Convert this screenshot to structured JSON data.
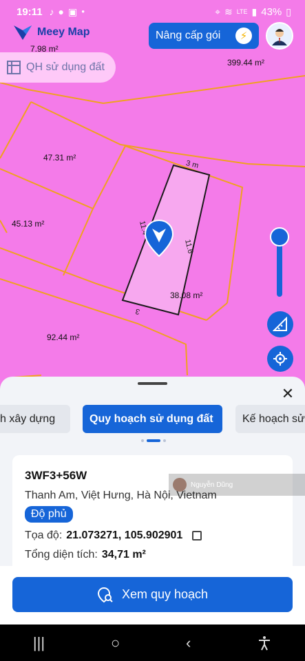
{
  "status_bar": {
    "time": "19:11",
    "battery": "43%",
    "left_icons": [
      "tiktok-icon",
      "mic-icon",
      "gallery-icon",
      "dot-icon"
    ],
    "right_icons": [
      "location-icon",
      "wifi-icon",
      "volte-icon",
      "signal-icon",
      "battery-icon"
    ]
  },
  "header": {
    "logo_text": "Meey Map",
    "upgrade_label": "Nâng cấp gói",
    "layer_chip_label": "QH sử dụng đất"
  },
  "map": {
    "area_labels": [
      "7.98 m²",
      "399.44 m²",
      "47.31 m²",
      "45.13 m²",
      "38.08 m²",
      "92.44 m²"
    ],
    "dimension_labels": [
      "3 m",
      "11.6",
      "11.4",
      "3"
    ],
    "colors": {
      "land": "#f47be9",
      "boundary": "#f0a11e",
      "selected": "#f7a8ef",
      "accent": "#1665d8"
    }
  },
  "sheet": {
    "tabs": [
      "h xây dựng",
      "Quy hoạch sử dụng đất",
      "Kế hoạch sử"
    ],
    "active_tab": 1,
    "card": {
      "plus_code": "3WF3+56W",
      "address": "Thanh Am, Việt Hưng, Hà Nội, Vietnam",
      "coverage_badge": "Độ phủ",
      "coords_label": "Tọa độ:",
      "coords_value": "21.073271, 105.902901",
      "area_label": "Tổng diện tích:",
      "area_value": "34,71 m²"
    },
    "watermark_name": "Nguyễn Dũng"
  },
  "cta": {
    "label": "Xem quy hoạch"
  },
  "navbar": {
    "recent": "|||",
    "home": "○",
    "back": "‹"
  }
}
